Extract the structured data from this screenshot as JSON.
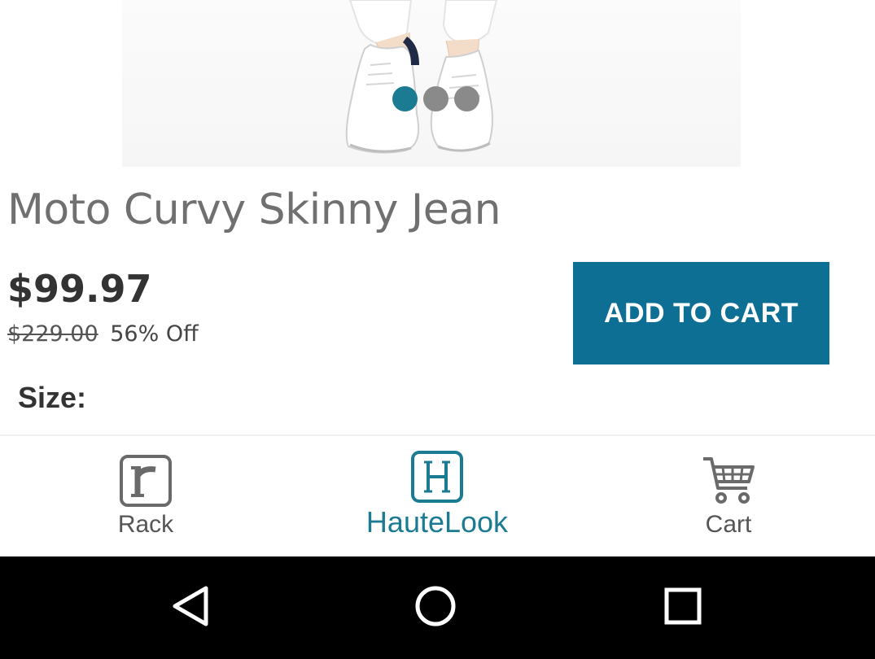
{
  "product": {
    "title": "Moto Curvy Skinny Jean",
    "sale_price": "$99.97",
    "original_price": "$229.00",
    "discount": "56% Off",
    "image_icon": "shoes-photo",
    "carousel": {
      "count": 3,
      "active_index": 0,
      "active_color": "#1a7b93",
      "inactive_color": "#8a8a8a"
    }
  },
  "actions": {
    "add_to_cart_label": "ADD TO CART",
    "button_color": "#0e6f94"
  },
  "size": {
    "label": "Size:"
  },
  "tab_bar": {
    "tabs": [
      {
        "label": "Rack",
        "icon": "rack-r-icon",
        "active": false
      },
      {
        "label": "HauteLook",
        "icon": "hautelook-h-icon",
        "active": true
      },
      {
        "label": "Cart",
        "icon": "cart-icon",
        "active": false
      }
    ],
    "active_color": "#1a7b93",
    "inactive_color": "#555555"
  },
  "system_nav": {
    "buttons": [
      "back-icon",
      "home-icon",
      "recents-icon"
    ]
  }
}
